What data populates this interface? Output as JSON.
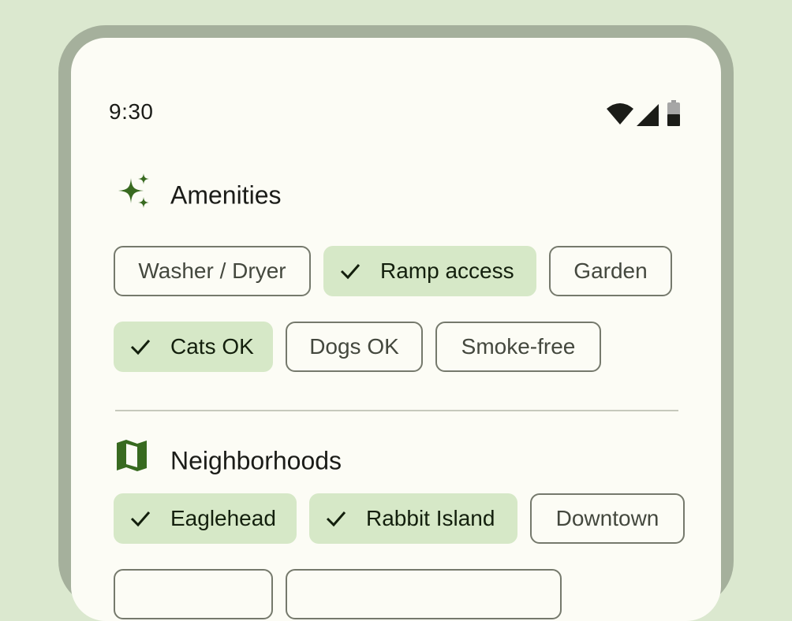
{
  "status_bar": {
    "time": "9:30",
    "icons": [
      "wifi-icon",
      "cellular-signal-icon",
      "battery-icon"
    ]
  },
  "amenities": {
    "title": "Amenities",
    "icon": "sparkle-icon",
    "chips": [
      {
        "label": "Washer / Dryer",
        "selected": false
      },
      {
        "label": "Ramp access",
        "selected": true
      },
      {
        "label": "Garden",
        "selected": false
      },
      {
        "label": "Cats OK",
        "selected": true
      },
      {
        "label": "Dogs OK",
        "selected": false
      },
      {
        "label": "Smoke-free",
        "selected": false
      }
    ]
  },
  "neighborhoods": {
    "title": "Neighborhoods",
    "icon": "map-icon",
    "chips": [
      {
        "label": "Eaglehead",
        "selected": true
      },
      {
        "label": "Rabbit Island",
        "selected": true
      },
      {
        "label": "Downtown",
        "selected": false
      }
    ]
  },
  "colors": {
    "background": "#dbe8cf",
    "frame": "#a5b09c",
    "surface": "#fcfcf5",
    "accent": "#386a20",
    "selected_chip": "#d6e8c7",
    "outline": "#75796c"
  }
}
